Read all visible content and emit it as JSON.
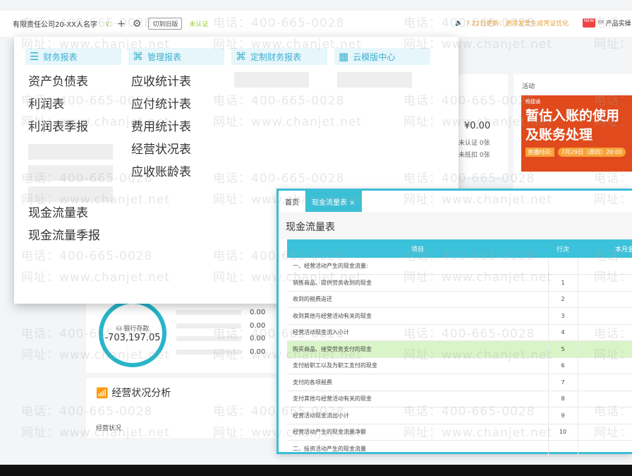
{
  "topbar": {
    "company": "有限责任公司20-XX人名字",
    "switch_old": "切到旧版",
    "unverified": "未认证",
    "notice": "7.22日更新：进项发票生成凭证优化",
    "new_badge": "NEW",
    "product": "产品实操"
  },
  "menu": {
    "columns": [
      {
        "title": "财务报表",
        "items": [
          "资产负债表",
          "利润表",
          "利润表季报"
        ],
        "items2": [
          "现金流量表",
          "现金流量季报"
        ]
      },
      {
        "title": "管理报表",
        "items": [
          "应收统计表",
          "应付统计表",
          "费用统计表",
          "经营状况表",
          "应收账龄表"
        ]
      },
      {
        "title": "定制财务报表",
        "items": []
      },
      {
        "title": "云模版中心",
        "items": []
      }
    ]
  },
  "dashboard": {
    "amount": "¥0.00",
    "unverified": "未认证 0张",
    "undeducted": "未抵扣 0张",
    "activity": "活动",
    "banner_brand": "畅捷通",
    "banner_line1": "暂估入账的使用",
    "banner_line2": "及账务处理",
    "banner_tag": "直播时间:",
    "banner_time": "7月29日（周四）20:00",
    "bank_label": "银行存款",
    "bank_value": "-703,197.05",
    "bars": [
      "0.00",
      "0.00",
      "0.00",
      "0.00"
    ],
    "analysis_title": "经营状况分析",
    "analysis_sub": "经营状况"
  },
  "window": {
    "tabs": [
      "首页",
      "现金流量表 ×"
    ],
    "title": "现金流量表",
    "headers": [
      "项目",
      "行次",
      "本月金"
    ],
    "rows": [
      [
        "一、经营活动产生的现金流量:",
        ""
      ],
      [
        "销售商品、提供劳务收到的现金",
        "1"
      ],
      [
        "收到的税费返还",
        "2"
      ],
      [
        "收到其他与经营活动有关的现金",
        "3"
      ],
      [
        "经营活动现金流入小计",
        "4"
      ],
      [
        "购买商品、接受劳务支付的现金",
        "5"
      ],
      [
        "支付给职工以及为职工支付的现金",
        "6"
      ],
      [
        "支付的各项税费",
        "7"
      ],
      [
        "支付其他与经营活动有关的现金",
        "8"
      ],
      [
        "经营活动现金流出小计",
        "9"
      ],
      [
        "经营活动产生的现金流量净额",
        "10"
      ],
      [
        "二、投资活动产生的现金流量",
        ""
      ]
    ]
  },
  "watermark": {
    "phone": "电话：400-665-0028",
    "site": "网址：www.chanjet.net"
  },
  "colors": {
    "accent": "#3bbfd6",
    "highlight": "#d9f5c8"
  }
}
